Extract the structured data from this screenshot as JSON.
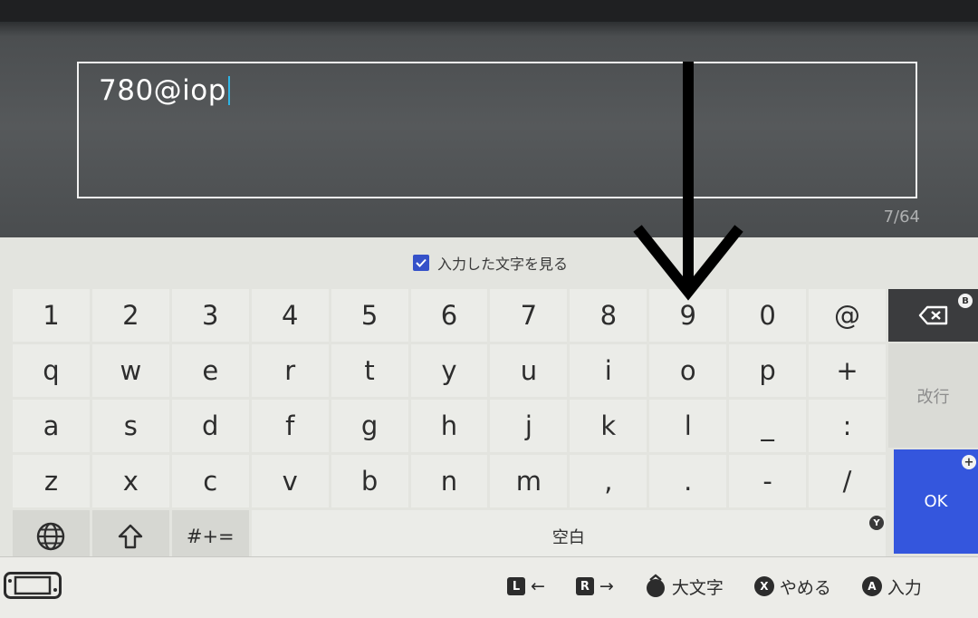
{
  "input": {
    "value": "780@iop",
    "char_count": "7/64"
  },
  "show_chars_label": "入力した文字を見る",
  "rows": [
    [
      "1",
      "2",
      "3",
      "4",
      "5",
      "6",
      "7",
      "8",
      "9",
      "0",
      "@"
    ],
    [
      "q",
      "w",
      "e",
      "r",
      "t",
      "y",
      "u",
      "i",
      "o",
      "p",
      "+"
    ],
    [
      "a",
      "s",
      "d",
      "f",
      "g",
      "h",
      "j",
      "k",
      "l",
      "_",
      ":"
    ],
    [
      "z",
      "x",
      "c",
      "v",
      "b",
      "n",
      "m",
      ",",
      ".",
      "-",
      "/"
    ]
  ],
  "bottom_row": {
    "symbols_label": "#+=",
    "space_label": "空白",
    "space_badge": "Y"
  },
  "side": {
    "backspace_badge": "B",
    "enter_label": "改行",
    "ok_label": "OK",
    "ok_badge": "+"
  },
  "hints": [
    {
      "button": "L",
      "label": "←"
    },
    {
      "button": "R",
      "label": "→"
    },
    {
      "button": "stick",
      "label": "大文字"
    },
    {
      "button": "X",
      "label": "やめる"
    },
    {
      "button": "A",
      "label": "入力"
    }
  ],
  "colors": {
    "accent": "#3456dd",
    "caret": "#2fb5e6"
  }
}
